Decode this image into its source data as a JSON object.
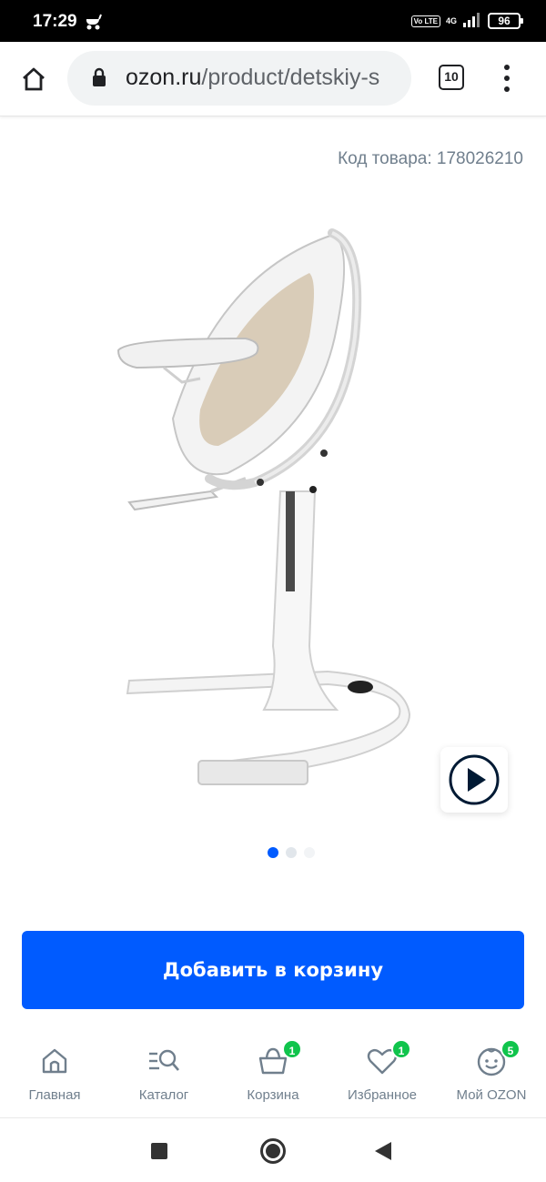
{
  "status_bar": {
    "time": "17:29",
    "volte": "Vo LTE",
    "network": "4G",
    "battery": "96"
  },
  "browser": {
    "url_domain": "ozon.ru",
    "url_path": "/product/detskiy-s",
    "tab_count": "10"
  },
  "product": {
    "code_label": "Код товара: 178026210",
    "image_count": 3,
    "active_image": 1
  },
  "cta": {
    "add_to_cart": "Добавить в корзину"
  },
  "bottom_nav": {
    "items": [
      {
        "label": "Главная",
        "icon": "home-icon"
      },
      {
        "label": "Каталог",
        "icon": "catalog-search-icon"
      },
      {
        "label": "Корзина",
        "icon": "cart-icon",
        "badge": "1"
      },
      {
        "label": "Избранное",
        "icon": "heart-icon",
        "badge": "1"
      },
      {
        "label": "Мой OZON",
        "icon": "profile-face-icon",
        "badge": "5"
      }
    ]
  },
  "colors": {
    "accent": "#005bff",
    "badge": "#10c44c",
    "muted_text": "#707f8d"
  }
}
